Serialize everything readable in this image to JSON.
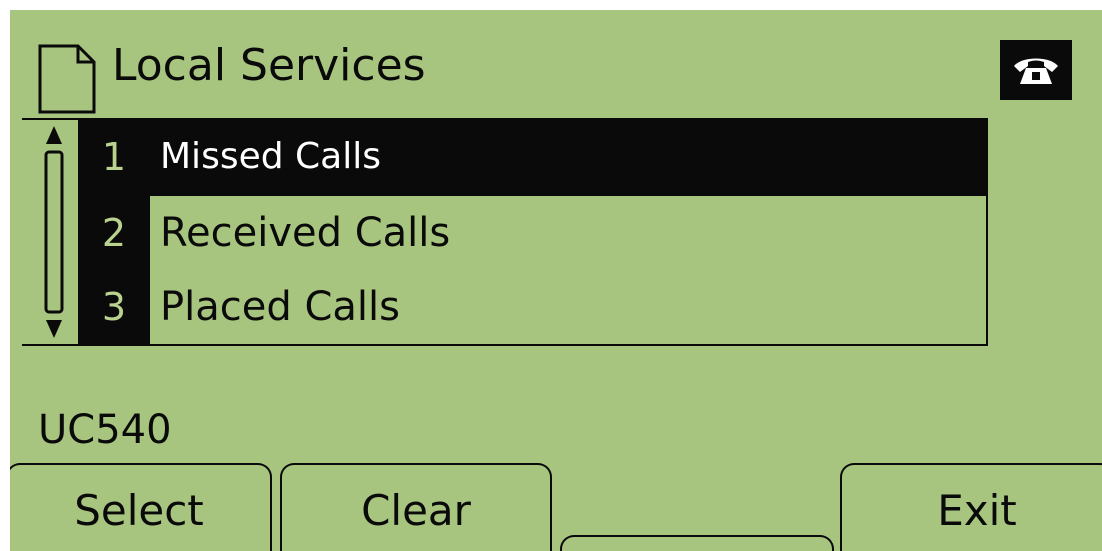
{
  "header": {
    "title": "Local Services",
    "icon": "document-icon",
    "status_icon": "handset-icon"
  },
  "menu": {
    "items": [
      {
        "number": "1",
        "label": "Missed Calls",
        "selected": true
      },
      {
        "number": "2",
        "label": "Received Calls",
        "selected": false
      },
      {
        "number": "3",
        "label": "Placed Calls",
        "selected": false
      }
    ]
  },
  "device_name": "UC540",
  "softkeys": [
    "Select",
    "Clear",
    "",
    "Exit"
  ],
  "colors": {
    "lcd_background": "#a8c57f",
    "foreground": "#0a0a0a",
    "selected_text": "#ffffff"
  }
}
